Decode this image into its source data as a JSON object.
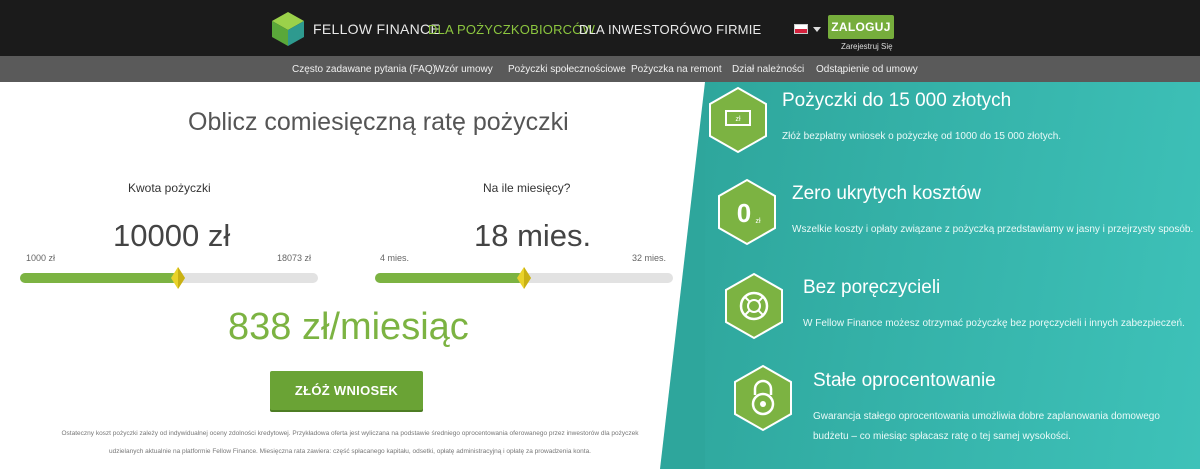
{
  "brand": {
    "name": "FELLOW FINANCE"
  },
  "nav": {
    "items": [
      "DLA POŻYCZKOBIORCÓW",
      "DLA INWESTORÓW",
      "O FIRMIE"
    ],
    "active_index": 0,
    "login": "ZALOGUJ",
    "register": "Zarejestruj Się",
    "lang_icon": "poland-flag-icon"
  },
  "subnav": {
    "items": [
      "Często zadawane pytania (FAQ)",
      "Wzór umowy",
      "Pożyczki społecznościowe",
      "Pożyczka na remont",
      "Dział należności",
      "Odstąpienie od umowy"
    ]
  },
  "calculator": {
    "title": "Oblicz comiesięczną ratę pożyczki",
    "amount": {
      "label": "Kwota pożyczki",
      "value": "10000 zł",
      "min": "1000 zł",
      "max": "18073 zł",
      "fraction": 0.53
    },
    "months": {
      "label": "Na ile miesięcy?",
      "value": "18 mies.",
      "min": "4 mies.",
      "max": "32 mies.",
      "fraction": 0.5
    },
    "result": "838 zł/miesiąc",
    "apply": "ZŁÓŻ WNIOSEK",
    "disclaimer_1": "Ostateczny koszt pożyczki zależy od indywidualnej oceny zdolności kredytowej. Przykładowa oferta jest wyliczana na podstawie średniego oprocentowania oferowanego przez inwestorów dla pożyczek",
    "disclaimer_2": "udzielanych aktualnie na platformie Fellow Finance. Miesięczna rata zawiera: część spłacanego kapitału, odsetki, opłatę administracyjną i opłatę za prowadzenia konta."
  },
  "features": [
    {
      "icon": "banknote-icon",
      "icon_text": "zł",
      "title": "Pożyczki do 15 000 złotych",
      "desc": "Złóż bezpłatny wniosek o pożyczkę od 1000 do 15 000 złotych."
    },
    {
      "icon": "zero-cost-icon",
      "icon_text": "0",
      "icon_sub": "zł",
      "title": "Zero ukrytych kosztów",
      "desc": "Wszelkie koszty i opłaty związane z pożyczką przedstawiamy w jasny i przejrzysty sposób."
    },
    {
      "icon": "lifebuoy-icon",
      "title": "Bez poręczycieli",
      "desc": "W Fellow Finance możesz otrzymać pożyczkę bez poręczycieli i innych zabezpieczeń."
    },
    {
      "icon": "padlock-icon",
      "title": "Stałe oprocentowanie",
      "desc_1": "Gwarancja stałego oprocentowania umożliwia dobre zaplanowania domowego",
      "desc_2": "budżetu – co miesiąc spłacasz ratę o tej samej wysokości."
    }
  ],
  "colors": {
    "accent": "#7cb342",
    "teal": "#36b4ab",
    "topbar": "#1b1b1b",
    "subbar": "#5a5a5a"
  }
}
